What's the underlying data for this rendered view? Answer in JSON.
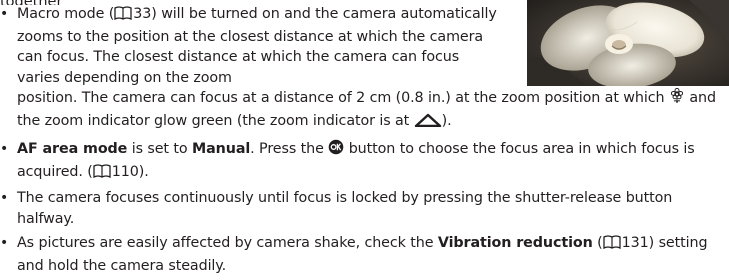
{
  "header_cut_text": "together",
  "bullets": [
    {
      "part1": "Macro mode (",
      "ref1": "33",
      "part2": ") will be turned on and the camera automatically zooms to the position at the closest distance at which the camera can focus. The closest distance at which the camera can focus varies depending on the zoom",
      "part3": "position. The camera can focus at a distance of 2 cm (0.8 in.) at the zoom position at which",
      "part4": "and the zoom indicator glow green (the zoom indicator is at",
      "part5": ")."
    },
    {
      "bold1": "AF area mode",
      "text1": " is set to ",
      "bold2": "Manual",
      "text2": ". Press the ",
      "text3": " button to choose the focus area in which focus is acquired. (",
      "ref1": "110",
      "text4": ")."
    },
    {
      "text1": "The camera focuses continuously until focus is locked by pressing the shutter-release button halfway."
    },
    {
      "text1": "As pictures are easily affected by camera shake, check the ",
      "bold1": "Vibration reduction",
      "text2": " (",
      "ref1": "131",
      "text3": ") setting and hold the camera steadily."
    }
  ],
  "icons": {
    "book": "book-reference-icon",
    "macro": "macro-flower-icon",
    "zoom": "zoom-indicator-triangle-icon",
    "ok": "ok-button-icon"
  },
  "photo": {
    "subject": "flower-close-up"
  }
}
